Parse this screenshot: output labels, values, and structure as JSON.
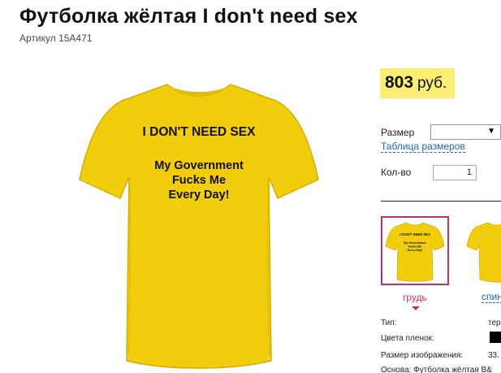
{
  "product": {
    "title": "Футболка жёлтая I don't need sex",
    "sku": "Артикул 15А471",
    "print_line1": "I DON'T NEED SEX",
    "print_line2a": "My Government",
    "print_line2b": "Fucks Me",
    "print_line2c": "Every Day!",
    "shirt_color": "#f2cd0c"
  },
  "price": {
    "value": "803",
    "currency": "руб.",
    "highlight_color": "#fcee75"
  },
  "options": {
    "size_label": "Размер",
    "size_value": "",
    "size_table_link": "Таблица размеров",
    "qty_label": "Кол-во",
    "qty_value": "1"
  },
  "views": {
    "front_label": "грудь",
    "back_label": "спин",
    "active_color": "#c2306a"
  },
  "specs": {
    "type_label": "Тип:",
    "type_value": "тер",
    "film_colors_label": "Цвета пленок:",
    "image_size_label": "Размер изображения:",
    "image_size_value": "33.",
    "base_label": "Основа: Футболка жёлтая В&"
  }
}
